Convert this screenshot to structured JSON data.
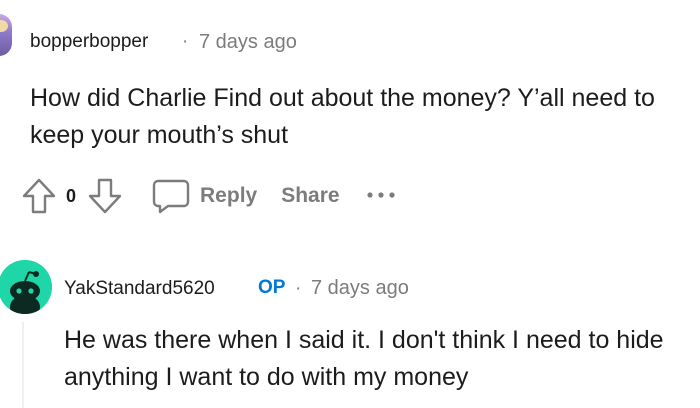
{
  "comment1": {
    "username": "bopperbopper",
    "separator": "·",
    "time": "7 days ago",
    "body": "How did Charlie Find out about the money? Y’all need to keep your mouth’s shut"
  },
  "actions": {
    "vote_count": "0",
    "reply_label": "Reply",
    "share_label": "Share",
    "more_label": "•••"
  },
  "comment2": {
    "username": "YakStandard5620",
    "op_badge": "OP",
    "separator": "·",
    "time": "7 days ago",
    "body": "He was there when I said it. I don't think I need to hide anything I want to do with my money"
  },
  "colors": {
    "text": "#1c1c1c",
    "meta": "#7c7c7c",
    "op_blue": "#0079d3",
    "avatar2_bg": "#1fd6a8"
  }
}
